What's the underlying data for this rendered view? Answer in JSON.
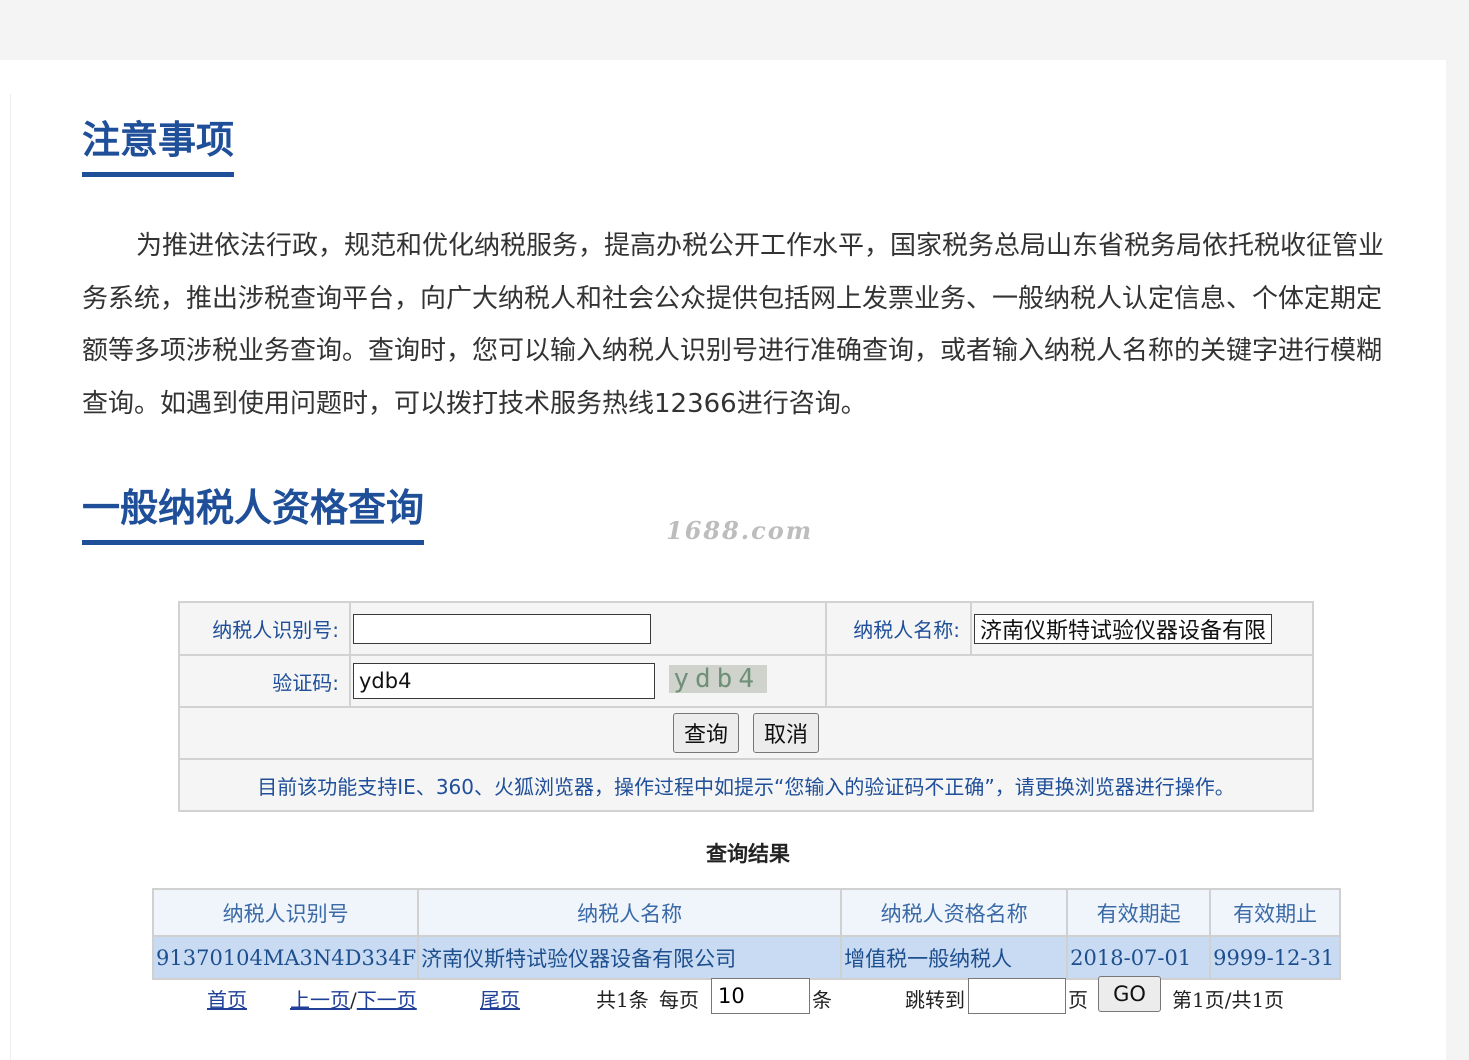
{
  "notice_section": {
    "title": "注意事项",
    "body": "为推进依法行政，规范和优化纳税服务，提高办税公开工作水平，国家税务总局山东省税务局依托税收征管业务系统，推出涉税查询平台，向广大纳税人和社会公众提供包括网上发票业务、一般纳税人认定信息、个体定期定额等多项涉税业务查询。查询时，您可以输入纳税人识别号进行准确查询，或者输入纳税人名称的关键字进行模糊查询。如遇到使用问题时，可以拨打技术服务热线12366进行咨询。"
  },
  "query_section": {
    "title": "一般纳税人资格查询"
  },
  "watermark": "1688.com",
  "form": {
    "taxpayer_id_label": "纳税人识别号:",
    "taxpayer_id_value": "",
    "taxpayer_name_label": "纳税人名称:",
    "taxpayer_name_value": "济南仪斯特试验仪器设备有限公司",
    "captcha_label": "验证码:",
    "captcha_value": "ydb4",
    "captcha_image_text": "ydb4",
    "query_button": "查询",
    "cancel_button": "取消",
    "browser_notice": "目前该功能支持IE、360、火狐浏览器，操作过程中如提示“您输入的验证码不正确”，请更换浏览器进行操作。"
  },
  "results": {
    "title": "查询结果",
    "columns": [
      "纳税人识别号",
      "纳税人名称",
      "纳税人资格名称",
      "有效期起",
      "有效期止"
    ],
    "rows": [
      [
        "91370104MA3N4D334F",
        "济南仪斯特试验仪器设备有限公司",
        "增值税一般纳税人",
        "2018-07-01",
        "9999-12-31"
      ]
    ]
  },
  "pager": {
    "first": "首页",
    "prev": "上一页",
    "separator": "/",
    "next": "下一页",
    "last": "尾页",
    "total": "共1条",
    "per_page_label": "每页",
    "per_page_value": "10",
    "per_page_unit": "条",
    "jump_label": "跳转到",
    "jump_value": "",
    "page_unit": "页",
    "go_button": "GO",
    "status": "第1页/共1页"
  }
}
